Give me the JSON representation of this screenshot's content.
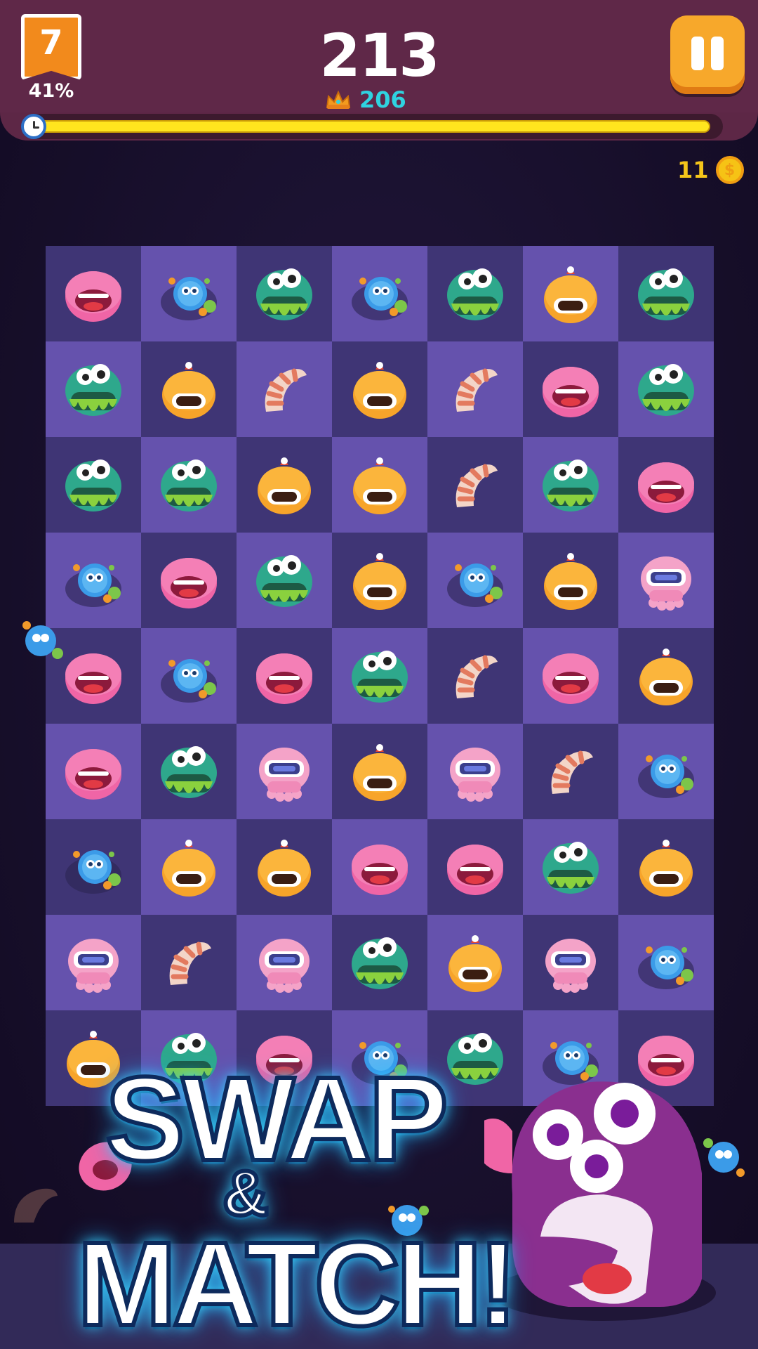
{
  "hud": {
    "level": "7",
    "level_progress": "41%",
    "score": "213",
    "best_score": "206",
    "timer_fraction": 0.99,
    "coins": "11",
    "coin_symbol": "$"
  },
  "promo": {
    "line1": "SWAP",
    "line2": "&",
    "line3": "MATCH!"
  },
  "colors": {
    "hud_bar": "#5f2848",
    "level_badge": "#f28a1c",
    "best_score": "#2fd3e0",
    "pause_button": "#f7a82b",
    "timer_fill": "#ffe51e",
    "coin": "#f6c315",
    "cell_dark": "#3f3575",
    "cell_light": "#6552ad"
  },
  "piece_types": {
    "pink": "pink-blob-monster",
    "green": "green-three-eyed-monster",
    "orange": "orange-antenna-monster",
    "worm": "striped-worm",
    "germ": "blue-germ-cluster",
    "robot": "pink-goggle-octopus"
  },
  "board": {
    "rows": [
      [
        "pink",
        "germ",
        "green",
        "germ",
        "green",
        "orange",
        "green"
      ],
      [
        "green",
        "orange",
        "worm",
        "orange",
        "worm",
        "pink",
        "green"
      ],
      [
        "green",
        "green",
        "orange",
        "orange",
        "worm",
        "green",
        "pink"
      ],
      [
        "germ",
        "pink",
        "green",
        "orange",
        "germ",
        "orange",
        "robot"
      ],
      [
        "pink",
        "germ",
        "pink",
        "green",
        "worm",
        "pink",
        "orange"
      ],
      [
        "pink",
        "green",
        "robot",
        "orange",
        "robot",
        "worm",
        "germ"
      ],
      [
        "germ",
        "orange",
        "orange",
        "pink",
        "pink",
        "green",
        "orange"
      ],
      [
        "robot",
        "worm",
        "robot",
        "green",
        "orange",
        "robot",
        "germ"
      ],
      [
        "orange",
        "green",
        "pink",
        "germ",
        "green",
        "germ",
        "pink"
      ]
    ]
  }
}
